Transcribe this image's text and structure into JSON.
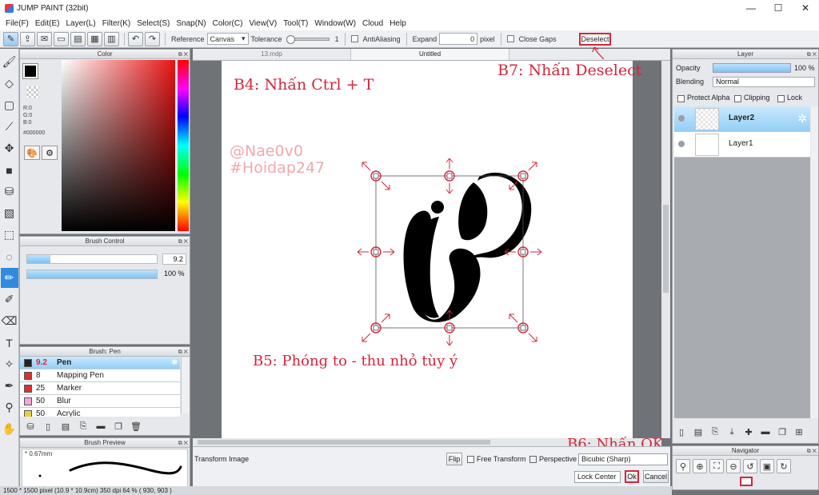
{
  "window": {
    "title": "JUMP PAINT (32bit)",
    "minimize": "—",
    "maximize": "☐",
    "close": "✕"
  },
  "menu": [
    "File(F)",
    "Edit(E)",
    "Layer(L)",
    "Filter(K)",
    "Select(S)",
    "Snap(N)",
    "Color(C)",
    "View(V)",
    "Tool(T)",
    "Window(W)",
    "Cloud",
    "Help"
  ],
  "toolbar": {
    "reference_label": "Reference",
    "reference_value": "Canvas",
    "tolerance_label": "Tolerance",
    "tolerance_value": "1",
    "antialiasing_label": "AntiAliasing",
    "expand_label": "Expand",
    "expand_value": "0",
    "expand_unit": "pixel",
    "close_gaps_label": "Close Gaps",
    "deselect_label": "Deselect"
  },
  "color_panel": {
    "title": "Color",
    "r": "R:0",
    "g": "G:0",
    "b": "B:0",
    "hex": "#000000",
    "fg_color": "#000000",
    "bg_color": "#f7b27b"
  },
  "brush_control": {
    "title": "Brush Control",
    "size_value": "9.2",
    "size_fill": 0.18,
    "opacity_value": "100 %",
    "opacity_fill": 1.0
  },
  "brush_list": {
    "title": "Brush: Pen",
    "items": [
      {
        "size": "9.2",
        "name": "Pen",
        "color": "#222222",
        "selected": true
      },
      {
        "size": "8",
        "name": "Mapping Pen",
        "color": "#d93030",
        "selected": false
      },
      {
        "size": "25",
        "name": "Marker",
        "color": "#d93030",
        "selected": false
      },
      {
        "size": "50",
        "name": "Blur",
        "color": "#f2a6d6",
        "selected": false
      },
      {
        "size": "50",
        "name": "Acrylic",
        "color": "#e5d33a",
        "selected": false
      }
    ]
  },
  "brush_preview": {
    "title": "Brush Preview",
    "size": "* 0.67mm"
  },
  "documents": {
    "tabs": [
      "13.mdp",
      "Untitled"
    ],
    "active": 1
  },
  "annotations": {
    "step4": "B4: Nhấn Ctrl + T",
    "step5": "B5: Phóng to - thu nhỏ tùy ý",
    "step6": "B6: Nhấn OK",
    "step7": "B7: Nhấn Deselect",
    "watermark1": "@Nae0v0",
    "watermark2": "#Hoidap247"
  },
  "transform": {
    "label": "Transform Image",
    "flip": "Flip",
    "free_transform": "Free Transform",
    "perspective": "Perspective",
    "interpolation": "Bicubic (Sharp)",
    "anchor": "Lock Center",
    "ok": "Ok",
    "cancel": "Cancel"
  },
  "status": "1500 * 1500 pixel  (10.9 * 10.9cm)  350 dpi  64 %  ( 930, 903 )",
  "layer_panel": {
    "title": "Layer",
    "opacity_label": "Opacity",
    "opacity_value": "100 %",
    "blending_label": "Blending",
    "blending_value": "Normal",
    "protect_alpha": "Protect Alpha",
    "clipping": "Clipping",
    "lock": "Lock",
    "layers": [
      {
        "name": "Layer2",
        "selected": true
      },
      {
        "name": "Layer1",
        "selected": false
      }
    ]
  },
  "navigator": {
    "title": "Navigator"
  },
  "colors": {
    "accent": "#d4263a",
    "selection": "#92cff6"
  }
}
